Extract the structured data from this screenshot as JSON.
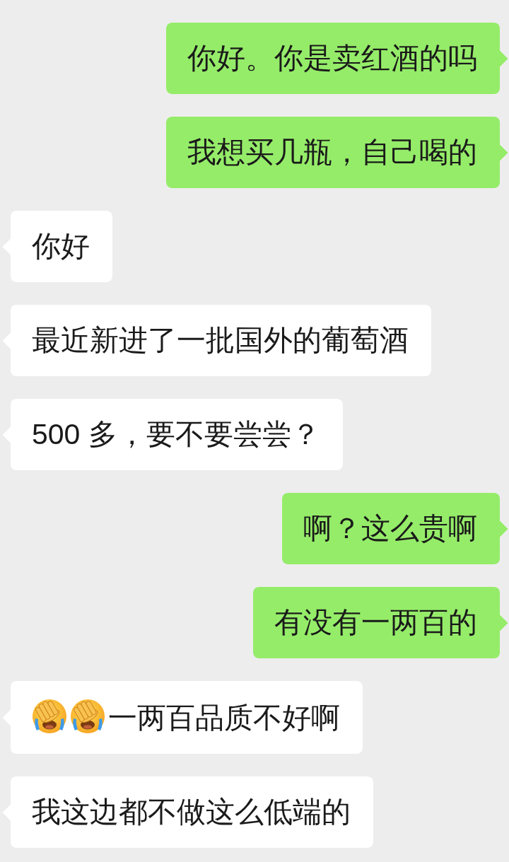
{
  "messages": [
    {
      "kind": "sent",
      "parts": [
        {
          "kind": "text",
          "text": "你好。你是卖红酒的吗"
        }
      ]
    },
    {
      "kind": "sent",
      "parts": [
        {
          "kind": "text",
          "text": "我想买几瓶，自己喝的"
        }
      ]
    },
    {
      "kind": "received",
      "parts": [
        {
          "kind": "text",
          "text": "你好"
        }
      ]
    },
    {
      "kind": "received",
      "parts": [
        {
          "kind": "text",
          "text": "最近新进了一批国外的葡萄酒"
        }
      ]
    },
    {
      "kind": "received",
      "parts": [
        {
          "kind": "text",
          "text": "500 多，要不要尝尝？"
        }
      ]
    },
    {
      "kind": "sent",
      "parts": [
        {
          "kind": "text",
          "text": "啊？这么贵啊"
        }
      ]
    },
    {
      "kind": "sent",
      "parts": [
        {
          "kind": "text",
          "text": "有没有一两百的"
        }
      ]
    },
    {
      "kind": "received",
      "parts": [
        {
          "kind": "emoji"
        },
        {
          "kind": "emoji"
        },
        {
          "kind": "text",
          "text": "一两百品质不好啊"
        }
      ]
    },
    {
      "kind": "received",
      "parts": [
        {
          "kind": "text",
          "text": "我这边都不做这么低端的"
        }
      ]
    }
  ]
}
